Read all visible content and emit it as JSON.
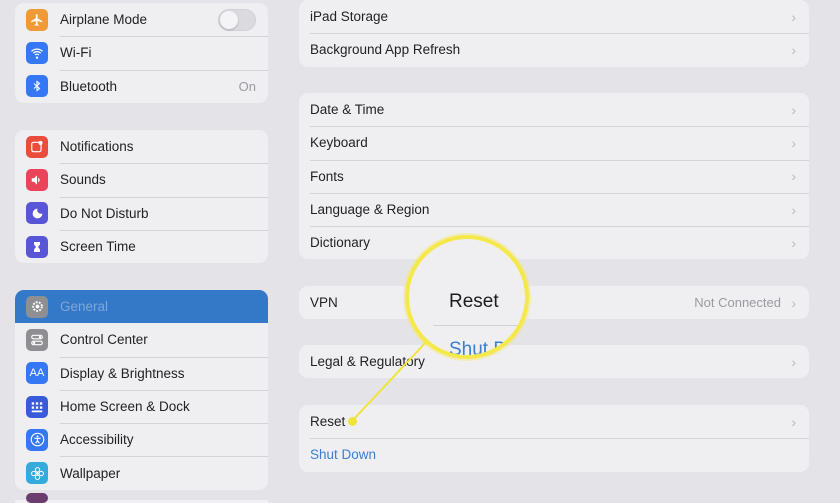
{
  "sidebar": {
    "groups": [
      {
        "items": [
          {
            "label": "Airplane Mode",
            "icon": "airplane-icon",
            "icon_color": "#f09a37",
            "control": "toggle",
            "toggle_on": false
          },
          {
            "label": "Wi-Fi",
            "icon": "wifi-icon",
            "icon_color": "#3478f6"
          },
          {
            "label": "Bluetooth",
            "icon": "bluetooth-icon",
            "icon_color": "#3478f6",
            "value": "On"
          }
        ]
      },
      {
        "items": [
          {
            "label": "Notifications",
            "icon": "notifications-icon",
            "icon_color": "#eb4d3d"
          },
          {
            "label": "Sounds",
            "icon": "sounds-icon",
            "icon_color": "#eb445a"
          },
          {
            "label": "Do Not Disturb",
            "icon": "moon-icon",
            "icon_color": "#5856d6"
          },
          {
            "label": "Screen Time",
            "icon": "hourglass-icon",
            "icon_color": "#5856d6"
          }
        ]
      },
      {
        "items": [
          {
            "label": "General",
            "icon": "gear-icon",
            "icon_color": "#8e8e93",
            "selected": true
          },
          {
            "label": "Control Center",
            "icon": "toggles-icon",
            "icon_color": "#8e8e93"
          },
          {
            "label": "Display & Brightness",
            "icon": "display-icon",
            "icon_color": "#3478f6"
          },
          {
            "label": "Home Screen & Dock",
            "icon": "grid-icon",
            "icon_color": "#3a5bd9"
          },
          {
            "label": "Accessibility",
            "icon": "accessibility-icon",
            "icon_color": "#3478f6"
          },
          {
            "label": "Wallpaper",
            "icon": "flower-icon",
            "icon_color": "#35aadc"
          }
        ]
      }
    ]
  },
  "main": {
    "groups": [
      {
        "items": [
          {
            "label": "iPad Storage"
          },
          {
            "label": "Background App Refresh"
          }
        ]
      },
      {
        "items": [
          {
            "label": "Date & Time"
          },
          {
            "label": "Keyboard"
          },
          {
            "label": "Fonts"
          },
          {
            "label": "Language & Region"
          },
          {
            "label": "Dictionary"
          }
        ]
      },
      {
        "items": [
          {
            "label": "VPN",
            "value": "Not Connected"
          }
        ]
      },
      {
        "items": [
          {
            "label": "Legal & Regulatory"
          }
        ]
      },
      {
        "items": [
          {
            "label": "Reset"
          },
          {
            "label": "Shut Down",
            "link": true
          }
        ]
      }
    ]
  },
  "callout": {
    "reset_label": "Reset",
    "shutdown_label": "Shut D",
    "highlight_color": "#f2e33a"
  },
  "accent_color": "#3478c8"
}
